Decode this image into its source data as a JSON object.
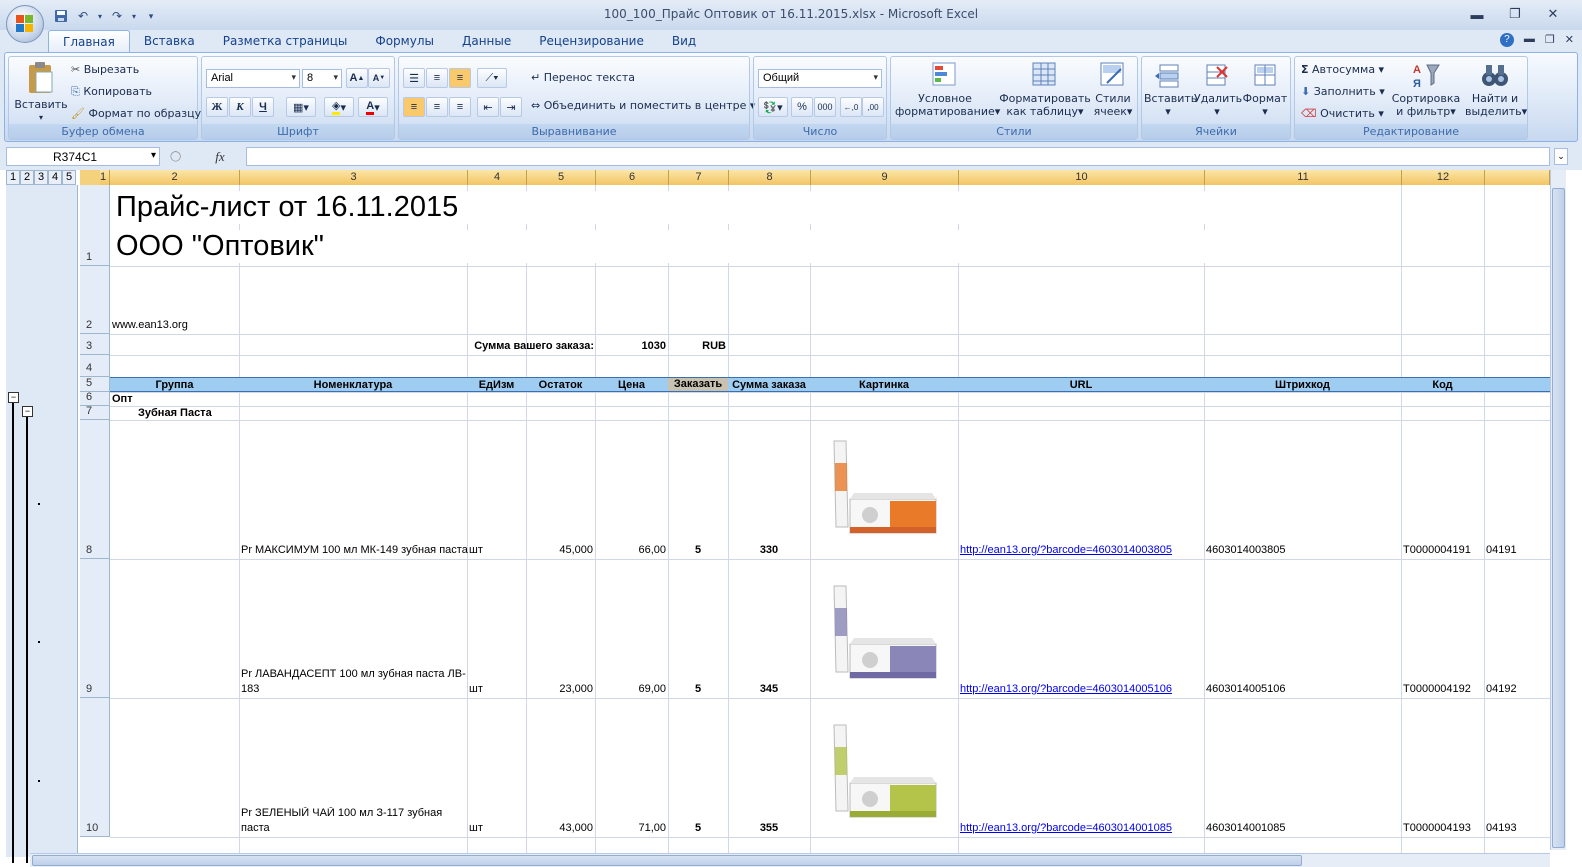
{
  "window": {
    "title": "100_100_Прайс Оптовик от 16.11.2015.xlsx - Microsoft Excel",
    "min": "▬",
    "max": "❐",
    "close": "✕"
  },
  "ribbon_tabs": [
    "Главная",
    "Вставка",
    "Разметка страницы",
    "Формулы",
    "Данные",
    "Рецензирование",
    "Вид"
  ],
  "clipboard": {
    "paste": "Вставить",
    "cut": "Вырезать",
    "copy": "Копировать",
    "format_painter": "Формат по образцу",
    "label": "Буфер обмена"
  },
  "font": {
    "name": "Arial",
    "size": "8",
    "bold": "Ж",
    "italic": "К",
    "underline": "Ч",
    "label": "Шрифт"
  },
  "alignment": {
    "wrap": "Перенос текста",
    "merge": "Объединить и поместить в центре",
    "label": "Выравнивание"
  },
  "number": {
    "format": "Общий",
    "percent": "%",
    "thousands": "000",
    "label": "Число"
  },
  "styles": {
    "conditional": [
      "Условное",
      "форматирование"
    ],
    "as_table": [
      "Форматировать",
      "как таблицу"
    ],
    "cell_styles": [
      "Стили",
      "ячеек"
    ],
    "label": "Стили"
  },
  "cells": {
    "insert": "Вставить",
    "delete": "Удалить",
    "format": "Формат",
    "label": "Ячейки"
  },
  "editing": {
    "autosum": "Автосумма",
    "fill": "Заполнить",
    "clear": "Очистить",
    "sort": [
      "Сортировка",
      "и фильтр"
    ],
    "find": [
      "Найти и",
      "выделить"
    ],
    "label": "Редактирование"
  },
  "formula_bar": {
    "namebox": "R374C1",
    "fx": "fx",
    "value": ""
  },
  "outline_levels": [
    "1",
    "2",
    "3",
    "4",
    "5"
  ],
  "columns": [
    "1",
    "2",
    "3",
    "4",
    "5",
    "6",
    "7",
    "8",
    "9",
    "10",
    "11",
    "12"
  ],
  "rows": [
    "1",
    "2",
    "3",
    "4",
    "5",
    "6",
    "7",
    "8",
    "9",
    "10"
  ],
  "sheet": {
    "title1": "Прайс-лист от 16.11.2015",
    "title2": "ООО \"Оптовик\"",
    "website": "www.ean13.org",
    "order_sum_label": "Сумма вашего заказа:",
    "order_sum_value": "1030",
    "currency": "RUB",
    "headers": [
      "Группа",
      "Номенклатура",
      "ЕдИзм",
      "Остаток",
      "Цена",
      "Заказать",
      "Сумма заказа",
      "Картинка",
      "URL",
      "Штрихкод",
      "Код"
    ],
    "group": "Опт",
    "subgroup": "Зубная Паста",
    "products": [
      {
        "name": "Pr МАКСИМУМ 100 мл МК-149 зубная паста",
        "unit": "шт",
        "stock": "45,000",
        "price": "66,00",
        "order": "5",
        "sum": "330",
        "url": "http://ean13.org/?barcode=4603014003805",
        "barcode": "4603014003805",
        "code": "Т0000004191",
        "code2": "04191",
        "accent": "#e87a2a"
      },
      {
        "name1": "Pr ЛАВАНДАСЕПТ 100 мл  зубная паста ЛВ-",
        "name2": "183",
        "unit": "шт",
        "stock": "23,000",
        "price": "69,00",
        "order": "5",
        "sum": "345",
        "url": "http://ean13.org/?barcode=4603014005106",
        "barcode": "4603014005106",
        "code": "Т0000004192",
        "code2": "04192",
        "accent": "#8a86b8"
      },
      {
        "name1": "Pr ЗЕЛЕНЫЙ ЧАЙ 100 мл З-117 зубная",
        "name2": "паста",
        "unit": "шт",
        "stock": "43,000",
        "price": "71,00",
        "order": "5",
        "sum": "355",
        "url": "http://ean13.org/?barcode=4603014001085",
        "barcode": "4603014001085",
        "code": "Т0000004193",
        "code2": "04193",
        "accent": "#b4c44a"
      }
    ]
  }
}
